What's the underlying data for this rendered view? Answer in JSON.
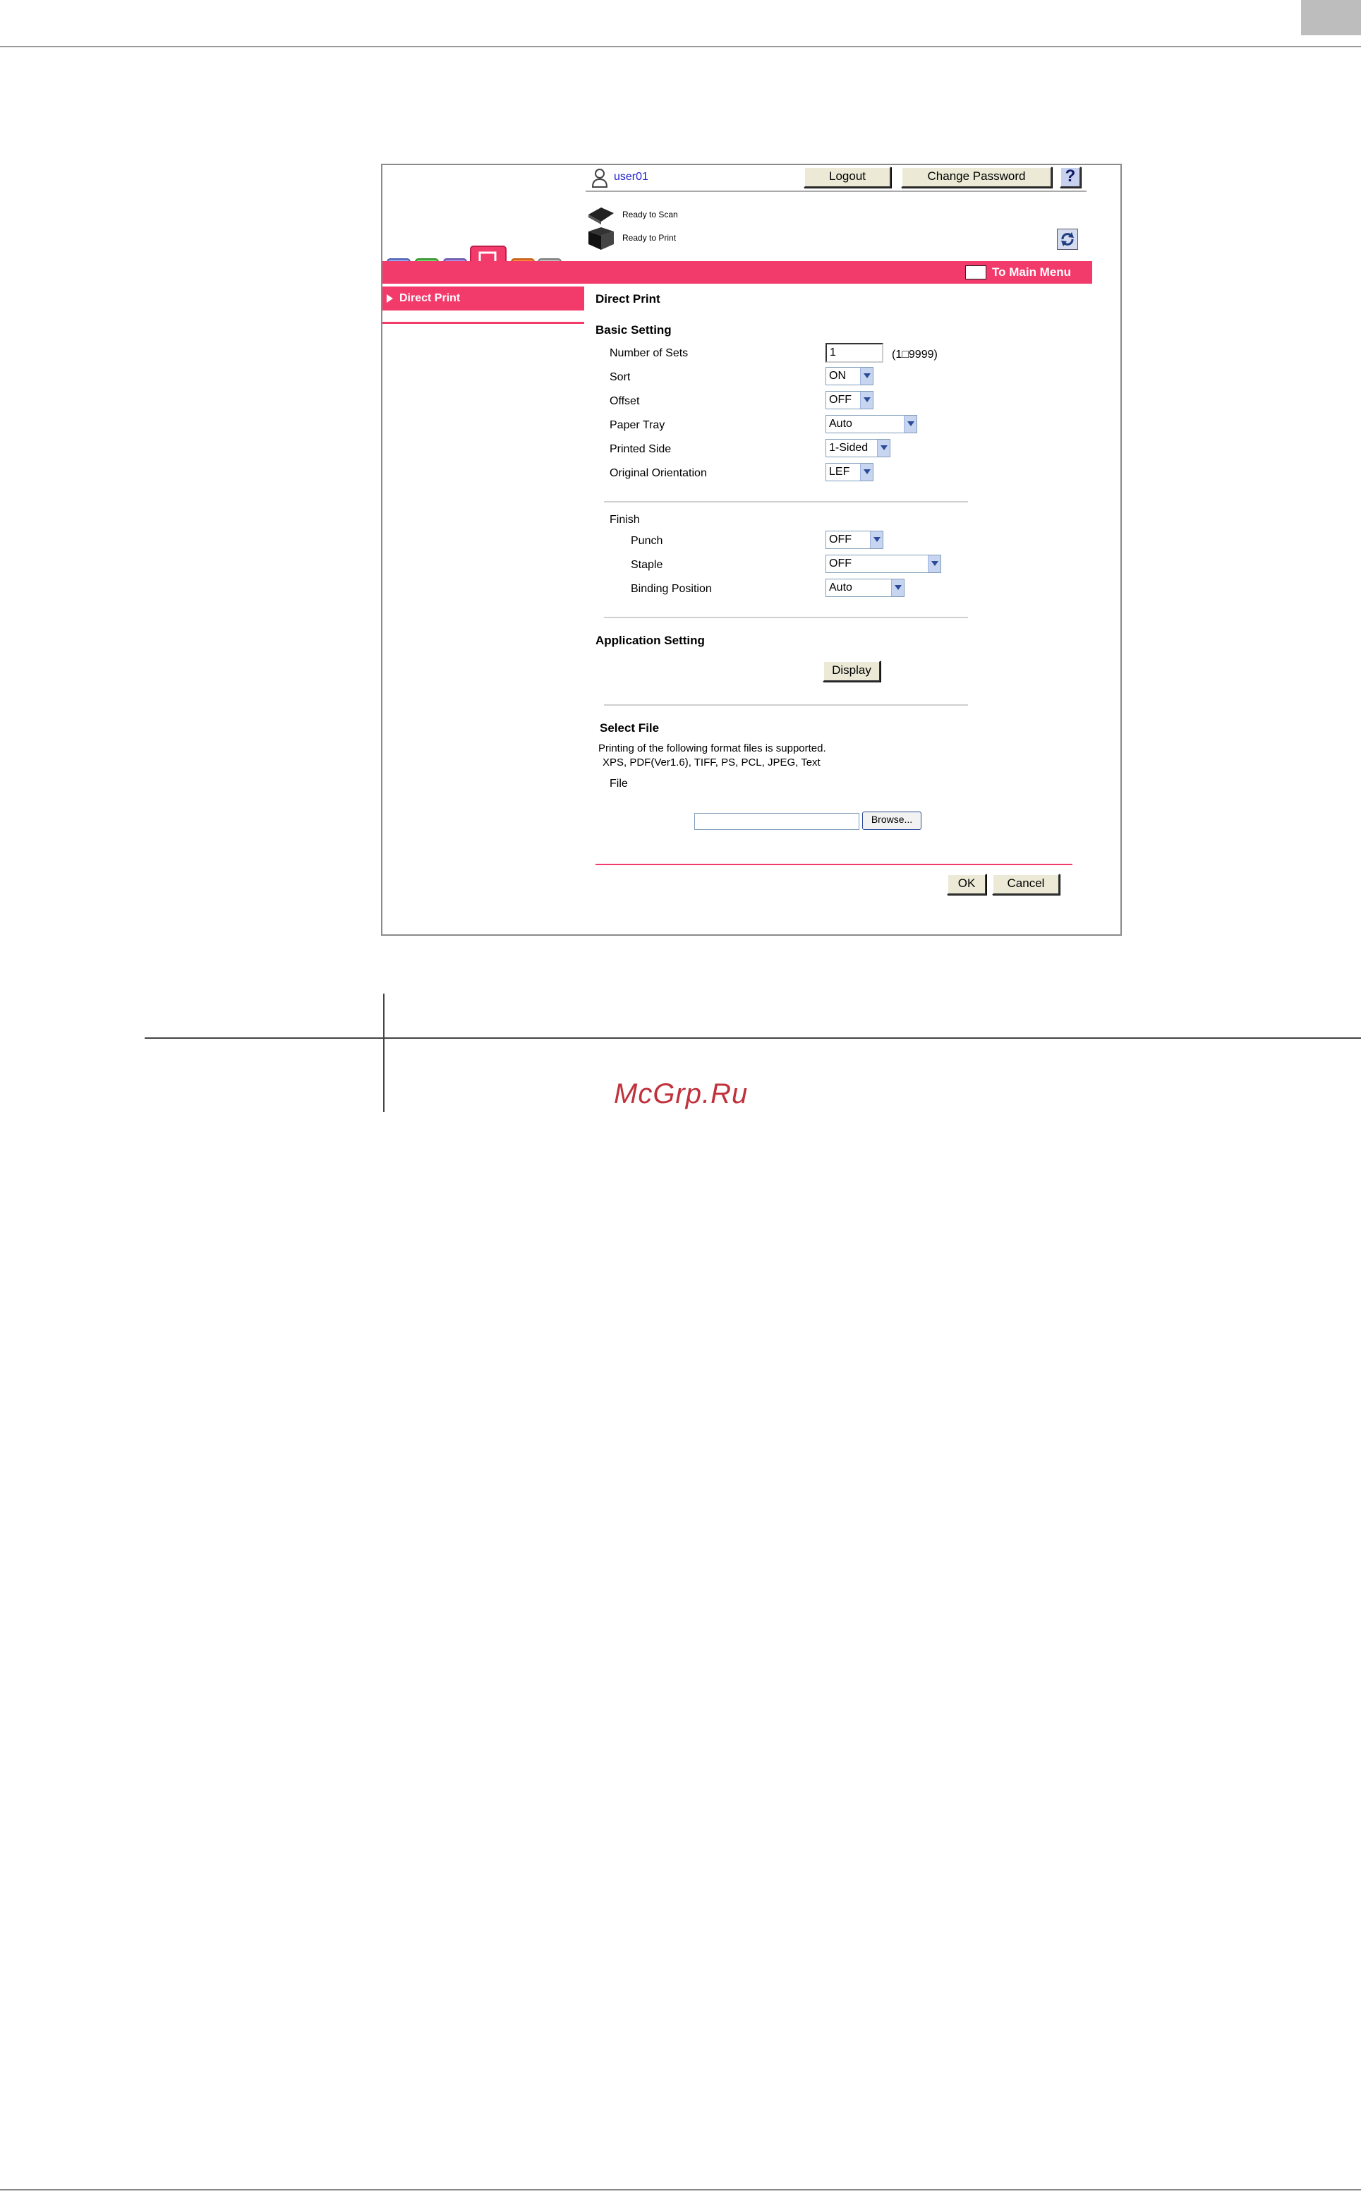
{
  "header": {
    "user": "user01",
    "logout_label": "Logout",
    "change_password_label": "Change Password",
    "help_label": "?",
    "status_scan": "Ready to Scan",
    "status_print": "Ready to Print",
    "main_menu_label": "To Main Menu"
  },
  "sidebar": {
    "items": [
      {
        "label": "Direct Print",
        "active": true
      }
    ]
  },
  "main": {
    "title": "Direct Print",
    "basic_setting": {
      "heading": "Basic Setting",
      "number_of_sets": {
        "label": "Number of Sets",
        "value": "1",
        "range": "(1□9999)"
      },
      "sort": {
        "label": "Sort",
        "value": "ON"
      },
      "offset": {
        "label": "Offset",
        "value": "OFF"
      },
      "paper_tray": {
        "label": "Paper Tray",
        "value": "Auto"
      },
      "printed_side": {
        "label": "Printed Side",
        "value": "1-Sided"
      },
      "original_orientation": {
        "label": "Original Orientation",
        "value": "LEF"
      }
    },
    "finish": {
      "heading": "Finish",
      "punch": {
        "label": "Punch",
        "value": "OFF"
      },
      "staple": {
        "label": "Staple",
        "value": "OFF"
      },
      "binding_position": {
        "label": "Binding Position",
        "value": "Auto"
      }
    },
    "application_setting": {
      "heading": "Application Setting",
      "display_label": "Display"
    },
    "select_file": {
      "heading": "Select File",
      "note_line1": "Printing of the following format files is supported.",
      "note_line2": "XPS, PDF(Ver1.6), TIFF, PS, PCL, JPEG, Text",
      "file_label": "File",
      "file_value": "",
      "browse_label": "Browse..."
    },
    "ok_label": "OK",
    "cancel_label": "Cancel"
  },
  "watermark": "McGrp.Ru",
  "colors": {
    "accent": "#f23a6b",
    "link": "#2222cc",
    "button_bg": "#ecead6"
  }
}
